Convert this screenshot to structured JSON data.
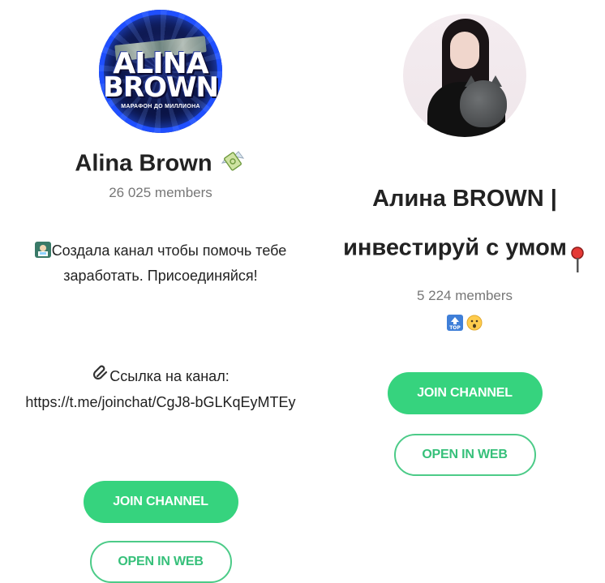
{
  "channels": [
    {
      "avatar": {
        "logo_line1": "ALINA",
        "logo_line2": "BROWN",
        "logo_sub": "МАРАФОН ДО МИЛЛИОНА"
      },
      "title": "Alina Brown",
      "title_icon": "money-wings-icon",
      "members": "26 025 members",
      "description": {
        "line1_icon": "computer-guy-icon",
        "line1": "Создала канал чтобы помочь тебе\nзаработать. Присоединяйся!",
        "line2_icon": "paperclip-icon",
        "line2": "Ссылка на канал:\nhttps://t.me/joinchat/CgJ8-bGLKqEyMTEy"
      },
      "join_label": "JOIN CHANNEL",
      "web_label": "OPEN IN WEB"
    },
    {
      "title": "Алина BROWN |\nинвестируй с умом",
      "title_icon": "pushpin-icon",
      "members": "5 224 members",
      "emojis": [
        "top-arrow-icon",
        "hushed-face-icon"
      ],
      "join_label": "JOIN CHANNEL",
      "web_label": "OPEN IN WEB"
    }
  ],
  "colors": {
    "accent_green": "#36d37e",
    "members_gray": "#777777"
  }
}
